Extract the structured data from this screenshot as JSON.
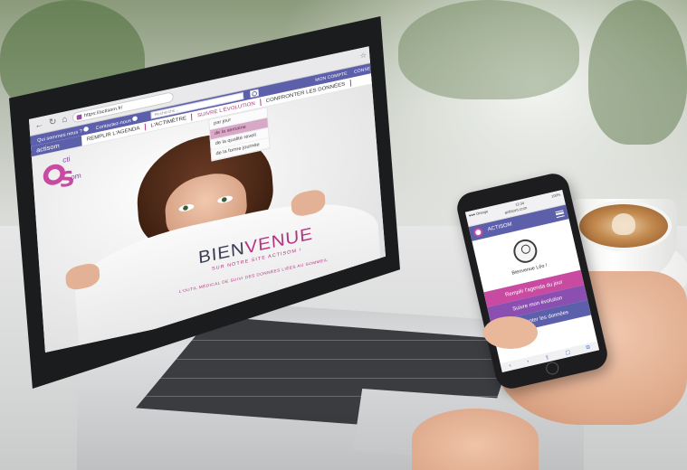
{
  "laptop": {
    "browser": {
      "url": "https://actisom.fr/",
      "back_icon": "arrow-left-icon",
      "reload_icon": "reload-icon",
      "home_icon": "home-icon",
      "star_icon": "star-icon",
      "share_icon": "share-icon"
    },
    "site_top": {
      "who_label": "Qui sommes nous ?",
      "contact_label": "Contactez-nous",
      "search_placeholder": "Recherche...",
      "account_label": "MON COMPTE",
      "advice_label": "CONSEILS"
    },
    "nav": {
      "brand": "actisom",
      "items": [
        {
          "label": "REMPLIR L'AGENDA"
        },
        {
          "label": "L'ACTIMÈTRE"
        },
        {
          "label": "SUIVRE L'ÉVOLUTION"
        },
        {
          "label": "CONFRONTER LES DONNÉES"
        }
      ]
    },
    "dropdown": {
      "items": [
        {
          "label": "par jour"
        },
        {
          "label": "de la semaine"
        },
        {
          "label": "de la qualité réveil"
        },
        {
          "label": "de la forme journée"
        }
      ]
    },
    "logo": {
      "cti": "cti",
      "om": "om"
    },
    "hero": {
      "title_part1": "BIEN",
      "title_part2": "VENUE",
      "subtitle": "SUR NOTRE SITE ACTISOM !",
      "tagline": "L'OUTIL MÉDICAL DE SUIVI DES DONNÉES LIÉES AU SOMMEIL"
    }
  },
  "phone": {
    "status_left": "●●● Orange",
    "status_time": "12:34",
    "status_right": "100%",
    "url": "actisom.com",
    "header_title": "ACTISOM",
    "welcome_text": "Bienvenue Léo !",
    "buttons": [
      {
        "label": "Remplir l'agenda du jour"
      },
      {
        "label": "Suivre mon évolution"
      },
      {
        "label": "Confronter les données"
      }
    ],
    "bottom_icons": [
      "‹",
      "›",
      "⇪",
      "☐",
      "⧉"
    ]
  },
  "colors": {
    "brand_purple": "#5c5fa9",
    "brand_pink": "#c94aa1",
    "brand_violet": "#8a4fb0"
  }
}
